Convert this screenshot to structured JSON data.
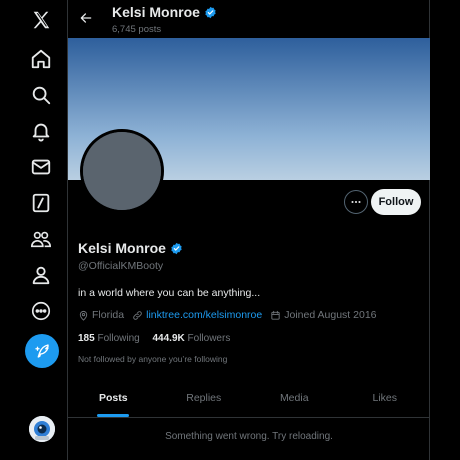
{
  "colors": {
    "accent": "#1d9bf0",
    "background": "#000000",
    "muted": "#71767b",
    "border": "#2f3336"
  },
  "sidebar": {
    "items": [
      {
        "icon": "x-logo-icon"
      },
      {
        "icon": "home-icon"
      },
      {
        "icon": "search-icon"
      },
      {
        "icon": "notifications-bell-icon"
      },
      {
        "icon": "messages-mail-icon"
      },
      {
        "icon": "grok-icon"
      },
      {
        "icon": "communities-icon"
      },
      {
        "icon": "profile-icon"
      },
      {
        "icon": "more-icon"
      }
    ],
    "compose_icon": "compose-post-icon"
  },
  "header": {
    "name": "Kelsi Monroe",
    "post_count": "6,745 posts"
  },
  "profile": {
    "display_name": "Kelsi Monroe",
    "handle": "@OfficialKMBooty",
    "bio": "in a world where you can be anything...",
    "location": "Florida",
    "link": "linktree.com/kelsimonroe",
    "joined": "Joined August 2016",
    "following_count": "185",
    "following_label": "Following",
    "followers_count": "444.9K",
    "followers_label": "Followers",
    "not_followed_text": "Not followed by anyone you’re following"
  },
  "actions": {
    "follow_label": "Follow"
  },
  "tabs": [
    {
      "label": "Posts",
      "active": true
    },
    {
      "label": "Replies"
    },
    {
      "label": "Media"
    },
    {
      "label": "Likes"
    }
  ],
  "error_text": "Something went wrong. Try reloading."
}
